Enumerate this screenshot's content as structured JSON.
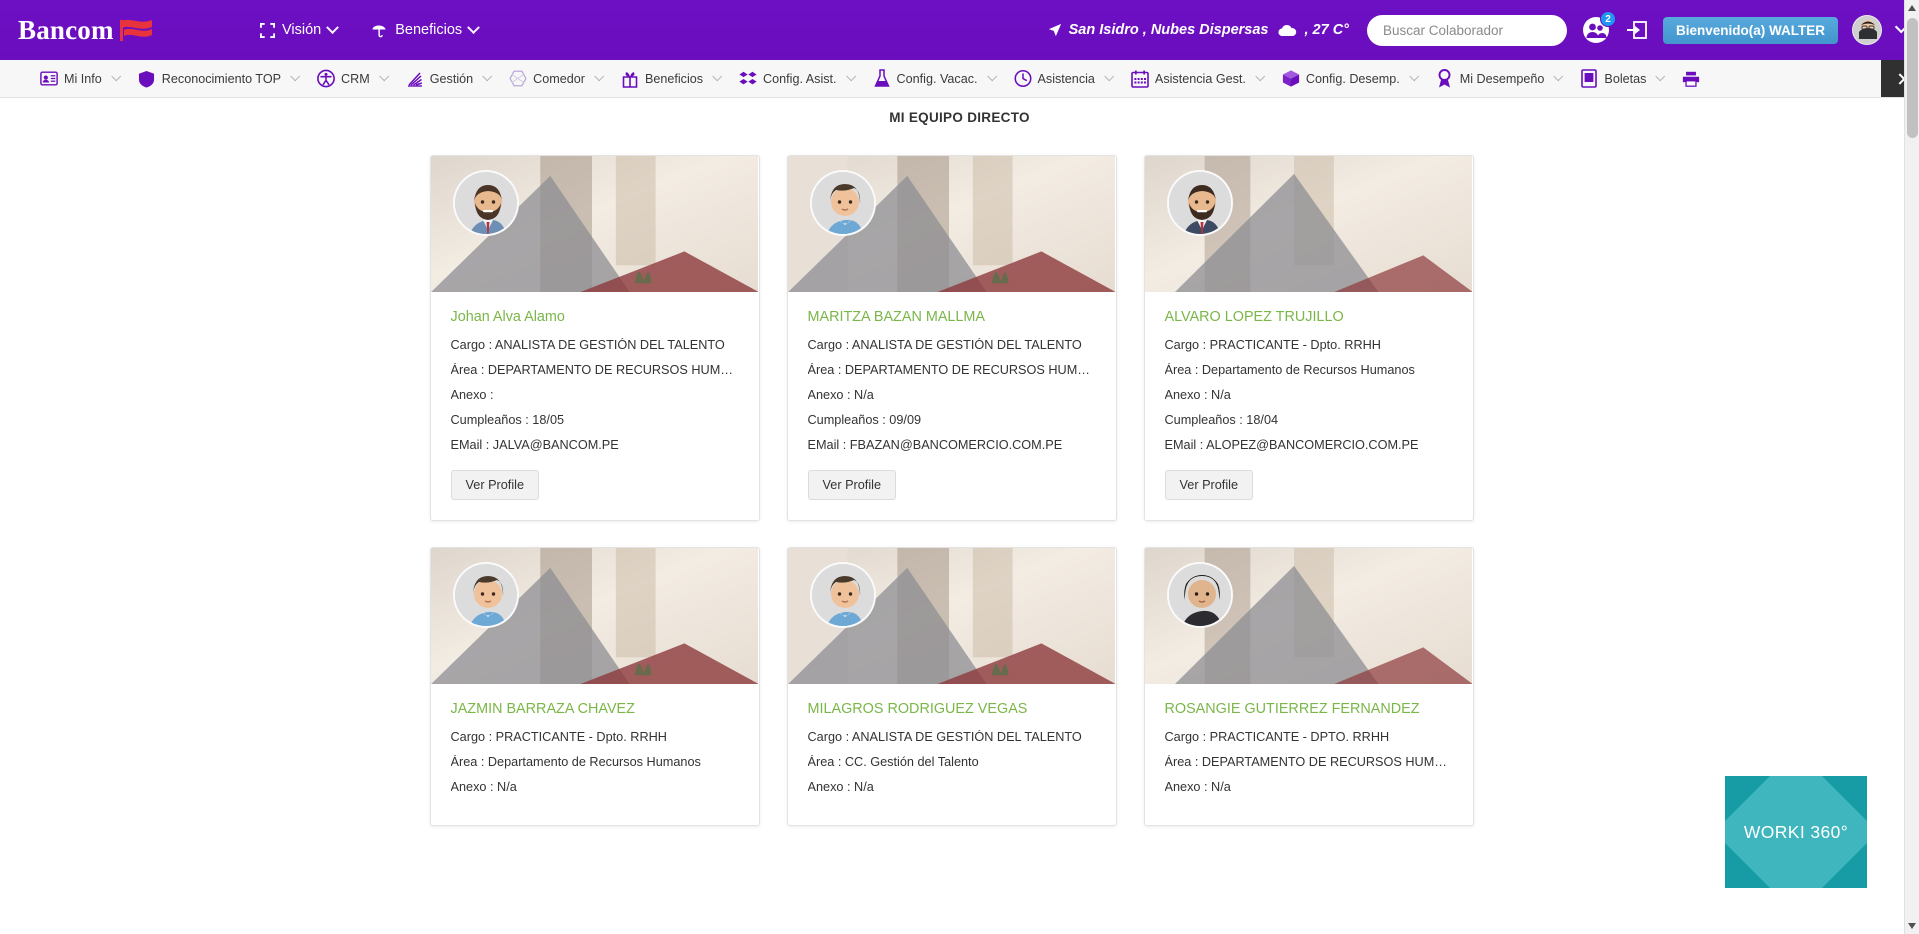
{
  "header": {
    "brand": "Bancom",
    "menu": [
      {
        "label": "Visión",
        "icon": "fullscreen-icon"
      },
      {
        "label": "Beneficios",
        "icon": "umbrella-icon"
      }
    ],
    "weather": {
      "location": "San Isidro , Nubes Dispersas",
      "temperature": ", 27 C°",
      "icon": "cloud-icon",
      "location_icon": "paper-plane-icon"
    },
    "search": {
      "placeholder": "Buscar Colaborador",
      "value": "",
      "icon": "search-icon"
    },
    "notifications": {
      "count": "2",
      "icon": "people-icon"
    },
    "logout_icon": "logout-icon",
    "welcome": "Bienvenido(a) WALTER",
    "avatar": "user-avatar",
    "user_caret": "chevron-down-icon"
  },
  "nav": {
    "items": [
      {
        "label": "Mi Info",
        "icon": "id-card-icon"
      },
      {
        "label": "Reconocimiento TOP",
        "icon": "shield-icon"
      },
      {
        "label": "CRM",
        "icon": "accessibility-icon"
      },
      {
        "label": "Gestión",
        "icon": "chart-icon"
      },
      {
        "label": "Comedor",
        "icon": "hexagon-icon"
      },
      {
        "label": "Beneficios",
        "icon": "gift-icon"
      },
      {
        "label": "Config. Asist.",
        "icon": "dropbox-icon"
      },
      {
        "label": "Config. Vacac.",
        "icon": "flask-icon"
      },
      {
        "label": "Asistencia",
        "icon": "clock-icon"
      },
      {
        "label": "Asistencia Gest.",
        "icon": "calendar-icon"
      },
      {
        "label": "Config. Desemp.",
        "icon": "cube-icon"
      },
      {
        "label": "Mi Desempeño",
        "icon": "award-icon"
      },
      {
        "label": "Boletas",
        "icon": "document-icon"
      },
      {
        "label": "",
        "icon": "printer-icon"
      }
    ],
    "scroll_right_icon": "chevron-right-icon"
  },
  "main": {
    "title": "MI EQUIPO DIRECTO",
    "button_label": "Ver Profile",
    "cards": [
      {
        "name": "Johan Alva Alamo",
        "cargo": "Cargo : ANALISTA DE GESTIÓN DEL TALENTO",
        "area": "Área : DEPARTAMENTO DE RECURSOS HUMANOS",
        "anexo": "Anexo :",
        "cumpleanos": "Cumpleaños : 18/05",
        "email": "EMail : JALVA@BANCOM.PE",
        "avatar_type": "male-beard"
      },
      {
        "name": "MARITZA BAZAN MALLMA",
        "cargo": "Cargo : ANALISTA DE GESTIÓN DEL TALENTO",
        "area": "Área : DEPARTAMENTO DE RECURSOS HUMANOS",
        "anexo": "Anexo : N/a",
        "cumpleanos": "Cumpleaños : 09/09",
        "email": "EMail : FBAZAN@BANCOMERCIO.COM.PE",
        "avatar_type": "female"
      },
      {
        "name": "ALVARO LOPEZ TRUJILLO",
        "cargo": "Cargo : PRACTICANTE - Dpto. RRHH",
        "area": "Área : Departamento de Recursos Humanos",
        "anexo": "Anexo : N/a",
        "cumpleanos": "Cumpleaños : 18/04",
        "email": "EMail : ALOPEZ@BANCOMERCIO.COM.PE",
        "avatar_type": "male-beard"
      },
      {
        "name": "JAZMIN BARRAZA CHAVEZ",
        "cargo": "Cargo : PRACTICANTE - Dpto. RRHH",
        "area": "Área : Departamento de Recursos Humanos",
        "anexo": "Anexo : N/a",
        "cumpleanos": "",
        "email": "",
        "avatar_type": "female"
      },
      {
        "name": "MILAGROS RODRIGUEZ VEGAS",
        "cargo": "Cargo : ANALISTA DE GESTIÓN DEL TALENTO",
        "area": "Área : CC. Gestión del Talento",
        "anexo": "Anexo : N/a",
        "cumpleanos": "",
        "email": "",
        "avatar_type": "female"
      },
      {
        "name": "ROSANGIE GUTIERREZ FERNANDEZ",
        "cargo": "Cargo : PRACTICANTE - DPTO. RRHH",
        "area": "Área : DEPARTAMENTO DE RECURSOS HUMANOS",
        "anexo": "Anexo : N/a",
        "cumpleanos": "",
        "email": "",
        "avatar_type": "female-dark"
      }
    ]
  },
  "worki": {
    "label": "WORKI 360°"
  },
  "colors": {
    "brand_purple": "#6a0dbd",
    "accent_green": "#7ab648",
    "welcome_blue": "#4a9fd4",
    "badge_blue": "#2196f3",
    "worki_teal": "#179ca5",
    "worki_teal_light": "#3fb6bd",
    "brand_red": "#e8323c"
  }
}
